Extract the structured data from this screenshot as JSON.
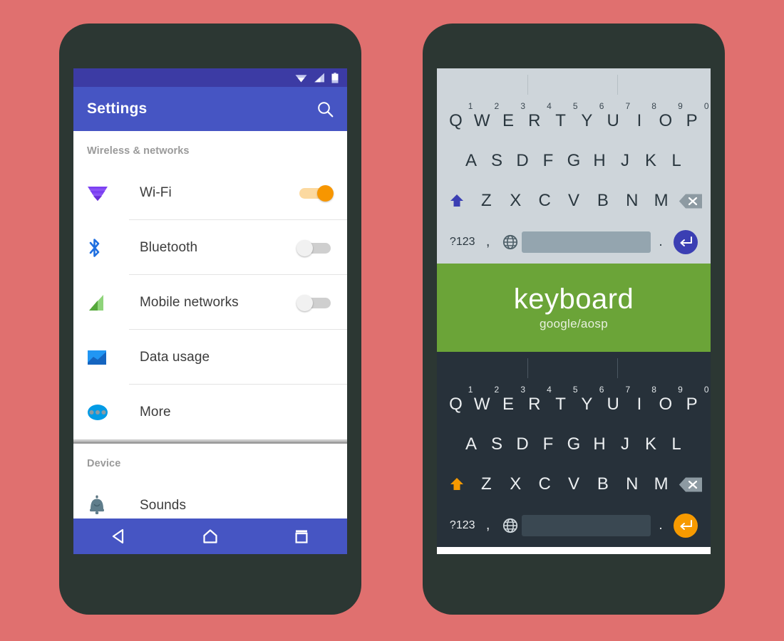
{
  "background_color": "#e0706f",
  "phone_frame_color": "#2c3733",
  "left_phone": {
    "name": "settings-phone",
    "status_bar": {
      "color": "#3c3ba4",
      "icons": [
        "wifi-icon",
        "cell-signal-icon",
        "battery-icon"
      ]
    },
    "app_bar": {
      "color": "#4655c3",
      "title": "Settings",
      "action_icon": "search-icon"
    },
    "sections": [
      {
        "header": "Wireless & networks",
        "rows": [
          {
            "label": "Wi-Fi",
            "icon": "wifi-cone-icon",
            "icon_color": "#7b3ff2",
            "control": "switch",
            "switch_on": true
          },
          {
            "label": "Bluetooth",
            "icon": "bluetooth-icon",
            "icon_color": "#1f6fe0",
            "control": "switch",
            "switch_on": false
          },
          {
            "label": "Mobile networks",
            "icon": "signal-bars-icon",
            "icon_color": "#64b54a",
            "control": "switch",
            "switch_on": false
          },
          {
            "label": "Data usage",
            "icon": "chart-icon",
            "icon_color": "#2196f3",
            "control": "none",
            "switch_on": false
          },
          {
            "label": "More",
            "icon": "more-dots-icon",
            "icon_color": "#039be5",
            "control": "none",
            "switch_on": false
          }
        ]
      },
      {
        "header": "Device",
        "rows": [
          {
            "label": "Sounds",
            "icon": "bell-icon",
            "icon_color": "#607d8b",
            "control": "none",
            "switch_on": false
          }
        ]
      }
    ],
    "nav_bar": {
      "color": "#4655c3",
      "buttons": [
        "back-icon",
        "home-icon",
        "recents-icon"
      ]
    }
  },
  "right_phone": {
    "name": "keyboard-showcase-phone",
    "keyboard_light": {
      "theme": "light",
      "background": "#ced5da",
      "key_color": "#2a373f",
      "suggestion_separators": 2,
      "rows": [
        {
          "keys": [
            "Q",
            "W",
            "E",
            "R",
            "T",
            "Y",
            "U",
            "I",
            "O",
            "P"
          ],
          "numbers": [
            "1",
            "2",
            "3",
            "4",
            "5",
            "6",
            "7",
            "8",
            "9",
            "0"
          ]
        },
        {
          "keys": [
            "A",
            "S",
            "D",
            "F",
            "G",
            "H",
            "J",
            "K",
            "L"
          ],
          "numbers": []
        },
        {
          "keys": [
            "Z",
            "X",
            "C",
            "V",
            "B",
            "N",
            "M"
          ],
          "numbers": [],
          "leading_icon": "shift-icon",
          "trailing_icon": "backspace-icon"
        }
      ],
      "bottom_row": {
        "symbols_label": "?123",
        "comma_label": ",",
        "globe_icon": "globe-icon",
        "space_label": "",
        "period_label": ".",
        "enter_icon": "enter-icon",
        "enter_color": "#3b3fb3"
      },
      "shift_color": "#3b3fb3"
    },
    "banner": {
      "background": "#6ba438",
      "title": "keyboard",
      "subtitle": "google/aosp"
    },
    "keyboard_dark": {
      "theme": "dark",
      "background": "#27313a",
      "key_color": "#eceff1",
      "suggestion_separators": 2,
      "rows": [
        {
          "keys": [
            "Q",
            "W",
            "E",
            "R",
            "T",
            "Y",
            "U",
            "I",
            "O",
            "P"
          ],
          "numbers": [
            "1",
            "2",
            "3",
            "4",
            "5",
            "6",
            "7",
            "8",
            "9",
            "0"
          ]
        },
        {
          "keys": [
            "A",
            "S",
            "D",
            "F",
            "G",
            "H",
            "J",
            "K",
            "L"
          ],
          "numbers": []
        },
        {
          "keys": [
            "Z",
            "X",
            "C",
            "V",
            "B",
            "N",
            "M"
          ],
          "numbers": [],
          "leading_icon": "shift-icon",
          "trailing_icon": "backspace-icon"
        }
      ],
      "bottom_row": {
        "symbols_label": "?123",
        "comma_label": ",",
        "globe_icon": "globe-icon",
        "space_label": "",
        "period_label": ".",
        "enter_icon": "enter-icon",
        "enter_color": "#f79a00"
      },
      "shift_color": "#f79a00"
    }
  }
}
